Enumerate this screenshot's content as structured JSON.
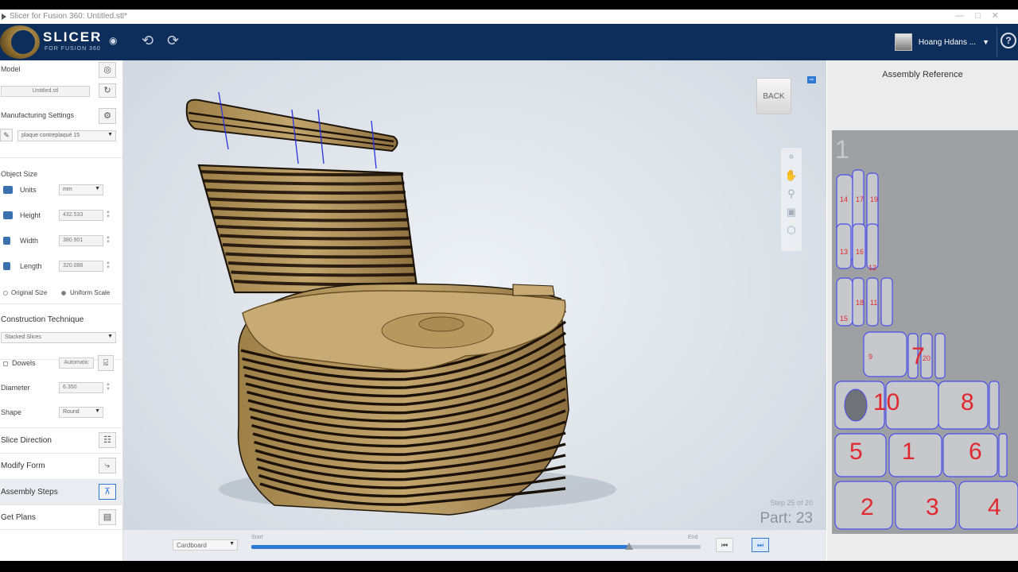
{
  "window": {
    "title": "Slicer for Fusion 360: Untitled.stl*"
  },
  "header": {
    "app_name": "SLICER",
    "app_sub": "FOR FUSION 360",
    "undo_icon": "undo-arrow-icon",
    "redo_icon": "redo-arrow-icon",
    "user_name": "Hoang Hdans ...",
    "help": "?"
  },
  "sidebar": {
    "model_label": "Model",
    "model_file": "Untitled.stl",
    "mfg_label": "Manufacturing Settings",
    "mfg_value": "plaque contreplaqué 15",
    "object_size_label": "Object Size",
    "units_label": "Units",
    "units_value": "mm",
    "height_label": "Height",
    "height_value": "432.533",
    "width_label": "Width",
    "width_value": "380.901",
    "length_label": "Length",
    "length_value": "320.088",
    "original_size": "Original Size",
    "uniform_scale": "Uniform Scale",
    "construction_label": "Construction Technique",
    "construction_value": "Stacked Slices",
    "dowels_label": "Dowels",
    "dowels_value": "Automatic",
    "diameter_label": "Diameter",
    "diameter_value": "6.350",
    "shape_label": "Shape",
    "shape_value": "Round",
    "slice_direction": "Slice Direction",
    "modify_form": "Modify Form",
    "assembly_steps": "Assembly Steps",
    "get_plans": "Get Plans"
  },
  "viewport": {
    "viewcube_label": "BACK",
    "step_text": "Step 25 of 20",
    "part_text": "Part: 23",
    "material_value": "Cardboard",
    "slider_start": "Start",
    "slider_end": "End",
    "slider_progress": 0.84
  },
  "reference": {
    "title": "Assembly Reference",
    "sheet_number": "1",
    "big_labels": [
      "7",
      "10",
      "8",
      "5",
      "1",
      "6",
      "2",
      "3",
      "4"
    ],
    "small_labels": [
      "14",
      "17",
      "19",
      "13",
      "16",
      "12",
      "15",
      "18",
      "11",
      "9",
      "20"
    ],
    "label_color": "#e0282e",
    "outline_color": "#4a4ff0"
  },
  "colors": {
    "header_bg": "#0d2d5a",
    "accent": "#2d7ad6",
    "wood": "#b99a62"
  }
}
